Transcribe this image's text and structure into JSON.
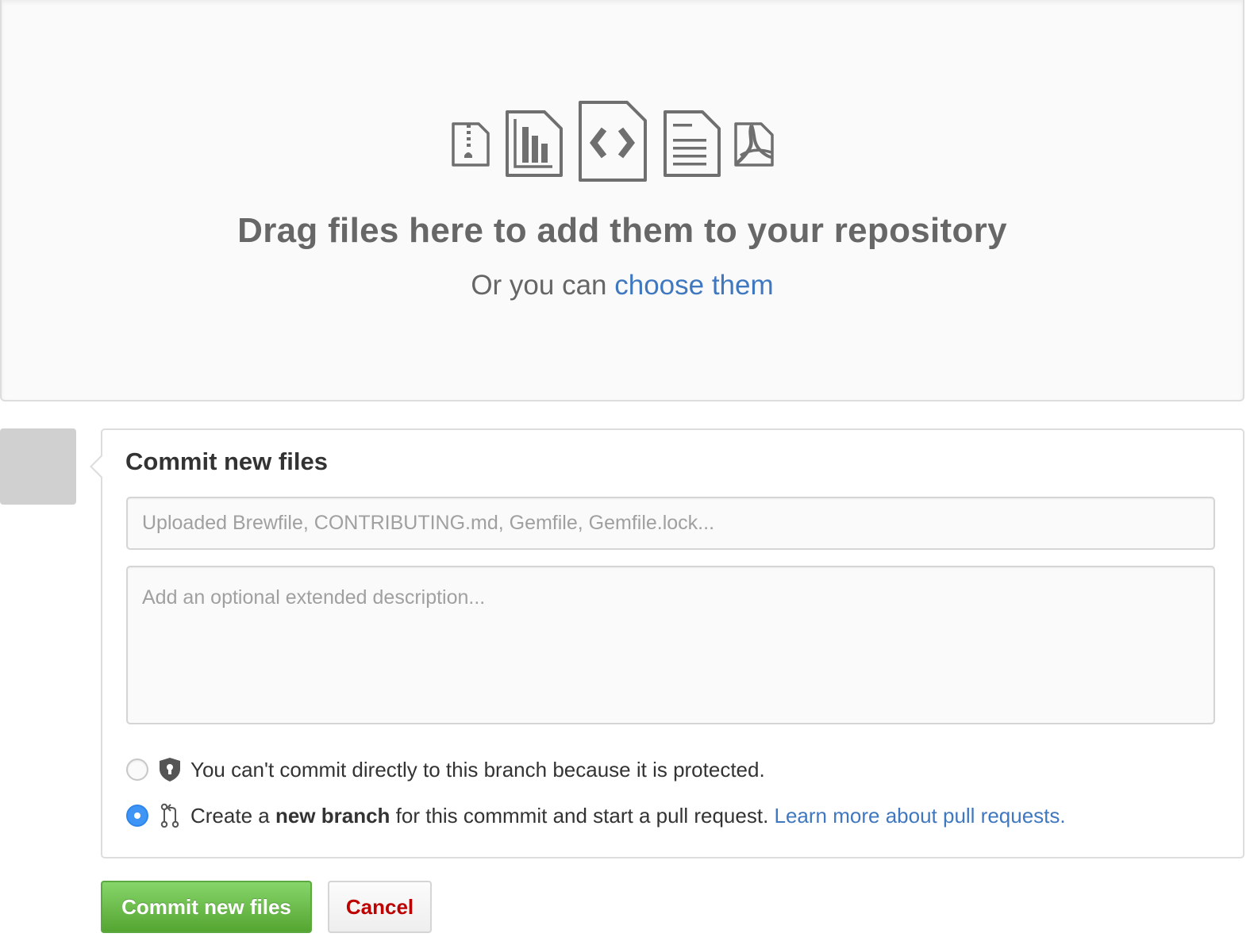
{
  "dropzone": {
    "file_icons": [
      {
        "name": "file-zip-icon"
      },
      {
        "name": "file-chart-icon"
      },
      {
        "name": "file-code-icon"
      },
      {
        "name": "file-text-icon"
      },
      {
        "name": "file-pdf-icon"
      }
    ],
    "title": "Drag files here to add them to your repository",
    "subtitle_prefix": "Or you can ",
    "choose_link": "choose them"
  },
  "commit": {
    "title": "Commit new files",
    "summary_placeholder": "Uploaded Brewfile, CONTRIBUTING.md, Gemfile, Gemfile.lock...",
    "summary_value": "",
    "description_placeholder": "Add an optional extended description...",
    "description_value": "",
    "options": [
      {
        "icon": "shield-lock-icon",
        "text": "You can't commit directly to this branch because it is protected.",
        "selected": false
      },
      {
        "icon": "git-pull-request-icon",
        "text_before": "Create a ",
        "text_bold": "new branch",
        "text_after": " for this commmit and start a pull request. ",
        "link": "Learn more about pull requests.",
        "selected": true
      }
    ]
  },
  "buttons": {
    "commit_label": "Commit new files",
    "cancel_label": "Cancel"
  },
  "colors": {
    "link": "#4078c0",
    "primary_button": "#55a532",
    "cancel_text": "#bd0000",
    "radio_selected": "#3e95f5",
    "icon_gray": "#6f6f6f"
  }
}
